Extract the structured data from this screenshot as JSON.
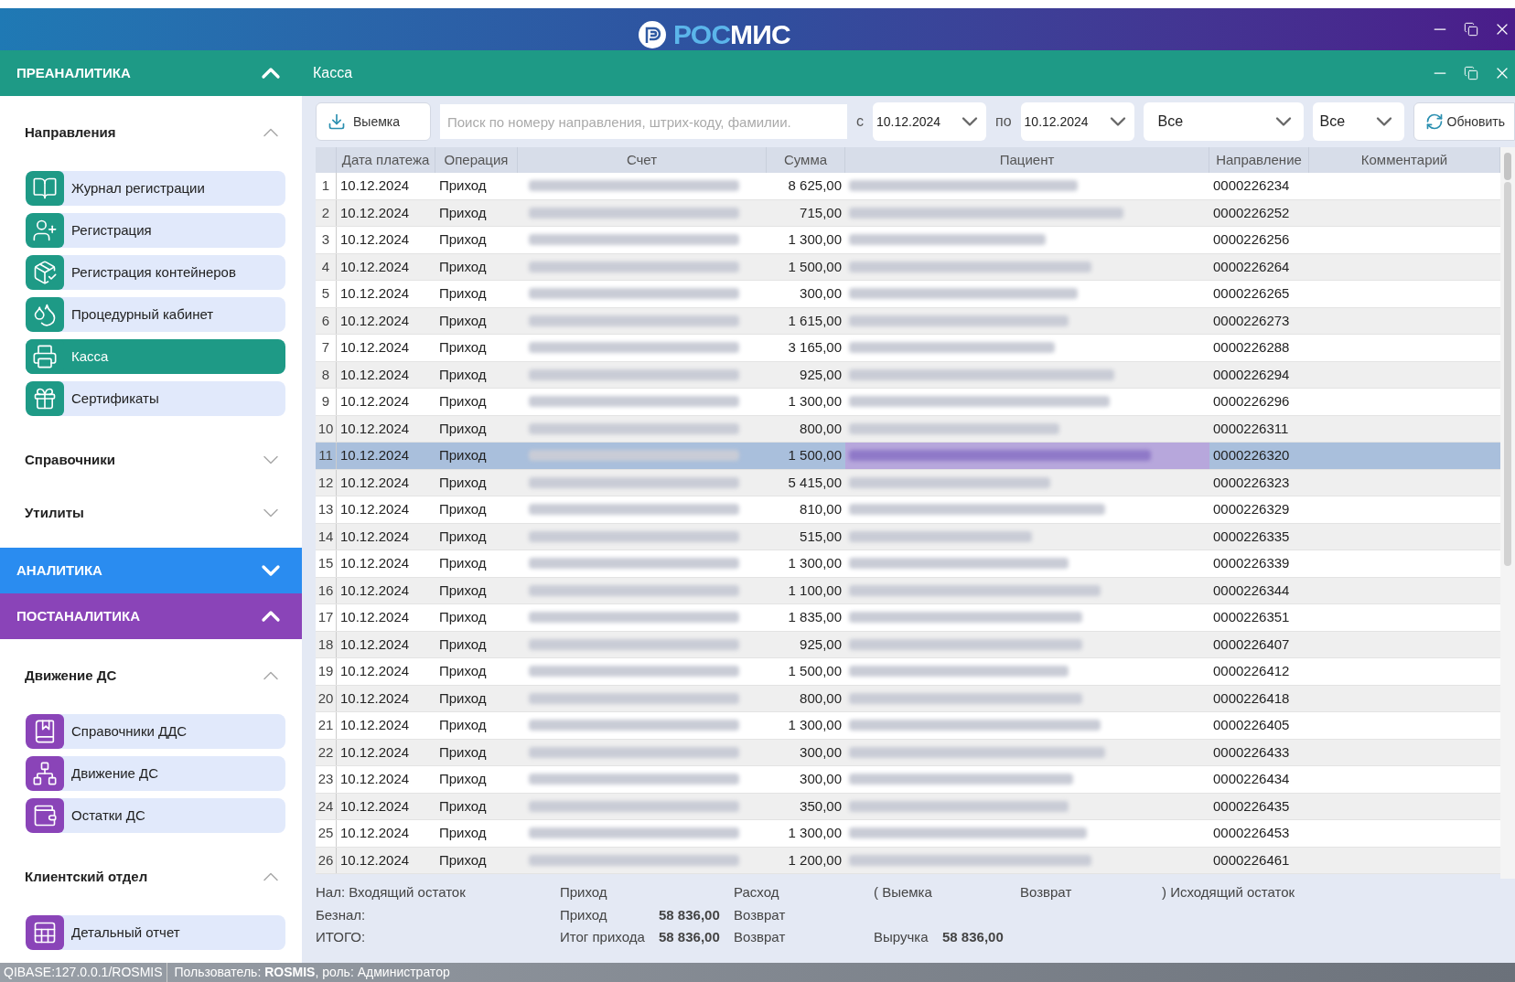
{
  "logo": [
    "РОС",
    "МИС"
  ],
  "sidebar": [
    {
      "title": "ПРЕАНАЛИТИКА",
      "color": "#1e9a86",
      "expanded": true,
      "groups": [
        {
          "title": "Направления",
          "expanded": true,
          "items": [
            {
              "label": "Журнал регистрации",
              "kind": "book",
              "selected": false
            },
            {
              "label": "Регистрация",
              "kind": "user",
              "selected": false
            },
            {
              "label": "Регистрация контейнеров",
              "kind": "container",
              "selected": false
            },
            {
              "label": "Процедурный кабинет",
              "kind": "drop",
              "selected": false
            },
            {
              "label": "Касса",
              "kind": "register",
              "selected": true
            },
            {
              "label": "Сертификаты",
              "kind": "gift",
              "selected": false
            }
          ]
        },
        {
          "title": "Справочники",
          "expanded": false
        },
        {
          "title": "Утилиты",
          "expanded": false
        }
      ]
    },
    {
      "title": "АНАЛИТИКА",
      "color": "#2a8cf0",
      "expanded": false
    },
    {
      "title": "ПОСТАНАЛИТИКА",
      "color": "#8a44b8",
      "expanded": true,
      "groups": [
        {
          "title": "Движение ДС",
          "expanded": true,
          "items": [
            {
              "label": "Справочники ДДС",
              "kind": "ledger",
              "selected": false
            },
            {
              "label": "Движение ДС",
              "kind": "network",
              "selected": false
            },
            {
              "label": "Остатки ДС",
              "kind": "wallet",
              "selected": false
            }
          ]
        },
        {
          "title": "Клиентский отдел",
          "expanded": true,
          "items": [
            {
              "label": "Детальный отчет",
              "kind": "report",
              "selected": false
            }
          ]
        }
      ]
    }
  ],
  "panel": {
    "title": "Касса"
  },
  "toolbar": {
    "withdraw_button": "Выемка",
    "search": {
      "placeholder": "Поиск по номеру направления, штрих-коду, фамилии."
    },
    "from_label": "с",
    "date_from": "10.12.2024",
    "to_label": "по",
    "date_to": "10.12.2024",
    "filter_1": "Все",
    "filter_2": "Все",
    "refresh_button": "Обновить"
  },
  "table": {
    "columns": [
      "Дата платежа",
      "Операция",
      "Счет",
      "Сумма",
      "Пациент",
      "Направление",
      "Комментарий"
    ],
    "rows": [
      {
        "n": "1",
        "date": "10.12.2024",
        "operation": "Приход",
        "amount": "8 625,00",
        "direction": "0000226234",
        "selected": false
      },
      {
        "n": "2",
        "date": "10.12.2024",
        "operation": "Приход",
        "amount": "715,00",
        "direction": "0000226252",
        "selected": false
      },
      {
        "n": "3",
        "date": "10.12.2024",
        "operation": "Приход",
        "amount": "1 300,00",
        "direction": "0000226256",
        "selected": false
      },
      {
        "n": "4",
        "date": "10.12.2024",
        "operation": "Приход",
        "amount": "1 500,00",
        "direction": "0000226264",
        "selected": false
      },
      {
        "n": "5",
        "date": "10.12.2024",
        "operation": "Приход",
        "amount": "300,00",
        "direction": "0000226265",
        "selected": false
      },
      {
        "n": "6",
        "date": "10.12.2024",
        "operation": "Приход",
        "amount": "1 615,00",
        "direction": "0000226273",
        "selected": false
      },
      {
        "n": "7",
        "date": "10.12.2024",
        "operation": "Приход",
        "amount": "3 165,00",
        "direction": "0000226288",
        "selected": false
      },
      {
        "n": "8",
        "date": "10.12.2024",
        "operation": "Приход",
        "amount": "925,00",
        "direction": "0000226294",
        "selected": false
      },
      {
        "n": "9",
        "date": "10.12.2024",
        "operation": "Приход",
        "amount": "1 300,00",
        "direction": "0000226296",
        "selected": false
      },
      {
        "n": "10",
        "date": "10.12.2024",
        "operation": "Приход",
        "amount": "800,00",
        "direction": "0000226311",
        "selected": false
      },
      {
        "n": "11",
        "date": "10.12.2024",
        "operation": "Приход",
        "amount": "1 500,00",
        "direction": "0000226320",
        "selected": true
      },
      {
        "n": "12",
        "date": "10.12.2024",
        "operation": "Приход",
        "amount": "5 415,00",
        "direction": "0000226323",
        "selected": false
      },
      {
        "n": "13",
        "date": "10.12.2024",
        "operation": "Приход",
        "amount": "810,00",
        "direction": "0000226329",
        "selected": false
      },
      {
        "n": "14",
        "date": "10.12.2024",
        "operation": "Приход",
        "amount": "515,00",
        "direction": "0000226335",
        "selected": false
      },
      {
        "n": "15",
        "date": "10.12.2024",
        "operation": "Приход",
        "amount": "1 300,00",
        "direction": "0000226339",
        "selected": false
      },
      {
        "n": "16",
        "date": "10.12.2024",
        "operation": "Приход",
        "amount": "1 100,00",
        "direction": "0000226344",
        "selected": false
      },
      {
        "n": "17",
        "date": "10.12.2024",
        "operation": "Приход",
        "amount": "1 835,00",
        "direction": "0000226351",
        "selected": false
      },
      {
        "n": "18",
        "date": "10.12.2024",
        "operation": "Приход",
        "amount": "925,00",
        "direction": "0000226407",
        "selected": false
      },
      {
        "n": "19",
        "date": "10.12.2024",
        "operation": "Приход",
        "amount": "1 500,00",
        "direction": "0000226412",
        "selected": false
      },
      {
        "n": "20",
        "date": "10.12.2024",
        "operation": "Приход",
        "amount": "800,00",
        "direction": "0000226418",
        "selected": false
      },
      {
        "n": "21",
        "date": "10.12.2024",
        "operation": "Приход",
        "amount": "1 300,00",
        "direction": "0000226405",
        "selected": false
      },
      {
        "n": "22",
        "date": "10.12.2024",
        "operation": "Приход",
        "amount": "300,00",
        "direction": "0000226433",
        "selected": false
      },
      {
        "n": "23",
        "date": "10.12.2024",
        "operation": "Приход",
        "amount": "300,00",
        "direction": "0000226434",
        "selected": false
      },
      {
        "n": "24",
        "date": "10.12.2024",
        "operation": "Приход",
        "amount": "350,00",
        "direction": "0000226435",
        "selected": false
      },
      {
        "n": "25",
        "date": "10.12.2024",
        "operation": "Приход",
        "amount": "1 300,00",
        "direction": "0000226453",
        "selected": false
      },
      {
        "n": "26",
        "date": "10.12.2024",
        "operation": "Приход",
        "amount": "1 200,00",
        "direction": "0000226461",
        "selected": false
      }
    ]
  },
  "totals": {
    "cash": {
      "label": "Нал: Входящий остаток",
      "income_label": "Приход",
      "expense_label": "Расход",
      "withdrawal_label": "( Выемка",
      "refund_label": "Возврат",
      "closing_label": ") Исходящий остаток"
    },
    "noncash": {
      "label": "Безнал:",
      "income_label": "Приход",
      "income": "58 836,00",
      "refund_label": "Возврат"
    },
    "total": {
      "label": "ИТОГО:",
      "income_label": "Итог прихода",
      "income": "58 836,00",
      "refund_label": "Возврат",
      "revenue_label": "Выручка",
      "revenue": "58 836,00"
    }
  },
  "status_bar": {
    "connection": "QIBASE:127.0.0.1/ROSMIS",
    "user": "Пользователь: **ROSMIS**, роль: Администратор"
  }
}
